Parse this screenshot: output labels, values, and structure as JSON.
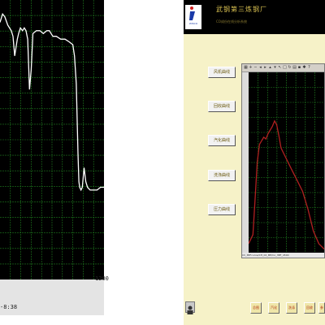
{
  "left_chart": {
    "time_label": "-8:38",
    "x_max_label": "1200"
  },
  "app": {
    "header": {
      "title": "武钢第三炼钢厂",
      "subtitle": "CO成份在线分析系统",
      "logo_text": "WISCO"
    },
    "side_menu": [
      {
        "label": "风机曲线"
      },
      {
        "label": "回收曲线"
      },
      {
        "label": "汽化曲线"
      },
      {
        "label": "洗涤曲线"
      },
      {
        "label": "压力曲线"
      }
    ],
    "chart_status": "Ch_3BFcurve/CH_02_ME/Co_3BF_4500",
    "footer_buttons": [
      {
        "label": "总图"
      },
      {
        "label": "汽化"
      },
      {
        "label": "洗涤"
      },
      {
        "label": "回收"
      },
      {
        "label": "参"
      }
    ],
    "colors": {
      "background": "#f6f2c8",
      "header": "#000000",
      "title": "#d8c050",
      "curve_left": "#ffffff",
      "curve_right": "#b02020"
    }
  },
  "chart_data": [
    {
      "type": "line",
      "x_range": [
        0,
        1200
      ],
      "grid": true,
      "series": [
        {
          "x": [
            0,
            30,
            55,
            90,
            130,
            150,
            170,
            200,
            215,
            235,
            260,
            280,
            300,
            320,
            340,
            360,
            380,
            420,
            460,
            500,
            540,
            570,
            590,
            610,
            650,
            700,
            750,
            800,
            840,
            860,
            880,
            890,
            900,
            910,
            920,
            935,
            950,
            970,
            990,
            1010,
            1040,
            1080,
            1120,
            1160,
            1200
          ],
          "y": [
            92,
            95,
            94,
            91,
            89,
            87,
            80,
            86,
            88,
            90,
            89,
            90,
            89,
            86,
            68,
            75,
            88,
            89,
            89,
            88,
            89,
            89,
            88,
            87,
            87,
            86,
            86,
            85,
            84,
            80,
            70,
            58,
            45,
            35,
            33,
            32,
            33,
            40,
            35,
            33,
            32,
            32,
            32,
            33,
            33
          ]
        }
      ]
    },
    {
      "type": "line",
      "grid": true,
      "series": [
        {
          "x": [
            0,
            4,
            6,
            8,
            10,
            12,
            14,
            16,
            18,
            20,
            22,
            24,
            26,
            28,
            30,
            35,
            40,
            45,
            50,
            55,
            60,
            65,
            70
          ],
          "y": [
            5,
            10,
            30,
            50,
            60,
            62,
            64,
            63,
            66,
            68,
            70,
            73,
            71,
            65,
            58,
            52,
            46,
            40,
            34,
            24,
            12,
            5,
            2
          ]
        }
      ]
    }
  ]
}
